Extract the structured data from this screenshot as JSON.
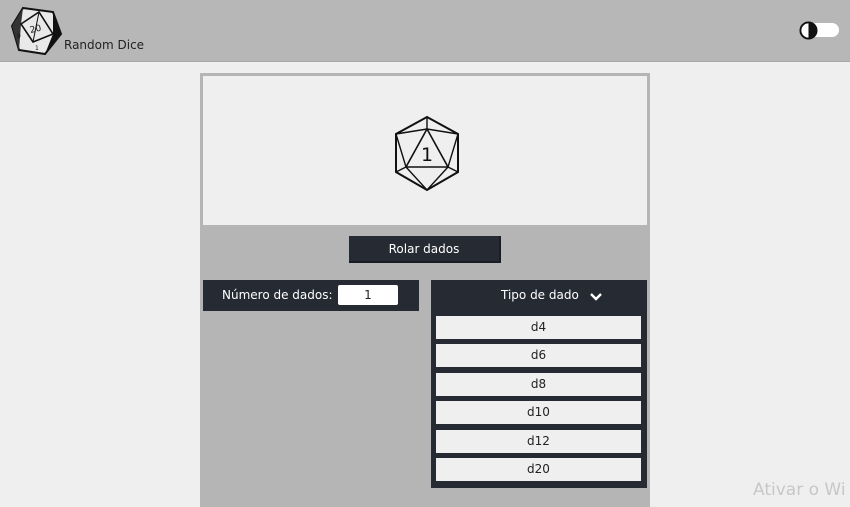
{
  "header": {
    "app_name": "Random Dice",
    "logo_icon": "d20-logo-icon",
    "theme_toggle_icon": "contrast-icon"
  },
  "dice": {
    "result": "1",
    "icon": "d20-icon"
  },
  "actions": {
    "roll_label": "Rolar dados"
  },
  "count": {
    "label": "Número de dados:",
    "value": "1"
  },
  "dice_type": {
    "label": "Tipo de dado",
    "options": [
      "d4",
      "d6",
      "d8",
      "d10",
      "d12",
      "d20"
    ]
  },
  "watermark": "Ativar o Wi",
  "colors": {
    "header_bg": "#b7b7b7",
    "page_bg": "#efefef",
    "panel_bg": "#b5b5b5",
    "dark": "#262a33"
  }
}
